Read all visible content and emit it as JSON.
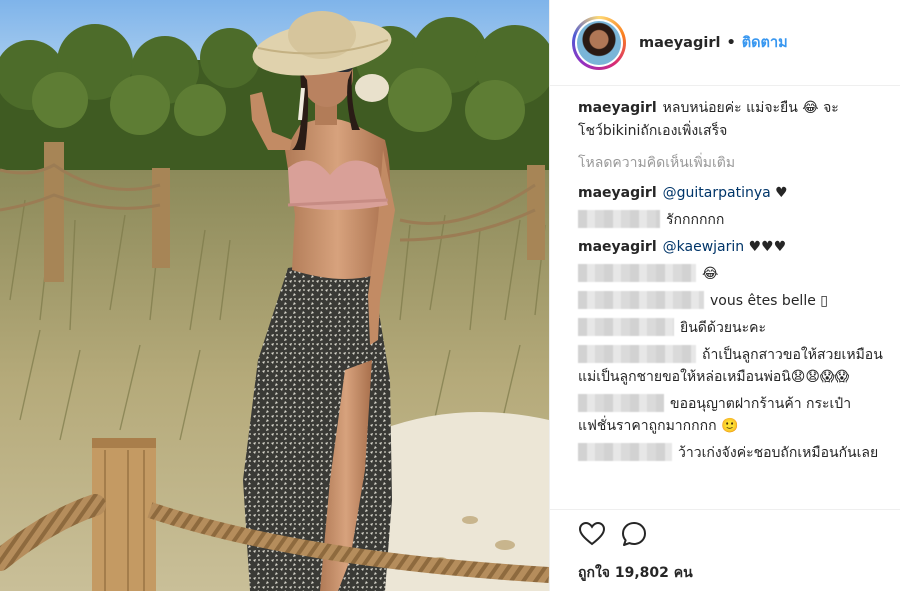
{
  "post": {
    "username": "maeyagirl",
    "separator": "•",
    "follow_label": "ติดตาม"
  },
  "caption": {
    "username": "maeyagirl",
    "text": "หลบหน่อยค่ะ แม่จะยืน 😂 จะโชว์bikiniถักเองเพิ่งเสร็จ"
  },
  "load_more_label": "โหลดความคิดเห็นเพิ่มเติม",
  "comments": [
    {
      "username": "maeyagirl",
      "mention": "@guitarpatinya",
      "text": "♥"
    },
    {
      "username": "",
      "text": "รักกกกกก"
    },
    {
      "username": "maeyagirl",
      "mention": "@kaewjarin",
      "text": "♥♥♥"
    },
    {
      "username": "",
      "text": "😂"
    },
    {
      "username": "",
      "text": "vous êtes belle ▯"
    },
    {
      "username": "",
      "text": "ยินดีด้วยนะคะ"
    },
    {
      "username": "",
      "text": "ถ้าเป็นลูกสาวขอให้สวยเหมือนแม่เป็นลูกชายขอให้หล่อเหมือนพ่อนิ😧😧😱😱"
    },
    {
      "username": "",
      "text": "ขออนุญาตฝากร้านค้า กระเป๋าแฟชั่นราคาถูกมากกกก 🙂"
    },
    {
      "username": "",
      "text": "ว้าวเก่งจังค่ะชอบถักเหมือนกันเลย"
    }
  ],
  "actions": {
    "like_icon": "heart-icon",
    "comment_icon": "speech-bubble-icon",
    "likes_text": "ถูกใจ 19,802 คน"
  },
  "colors": {
    "link": "#3897f0",
    "mention": "#003569",
    "muted": "#999999",
    "border": "#efefef"
  }
}
